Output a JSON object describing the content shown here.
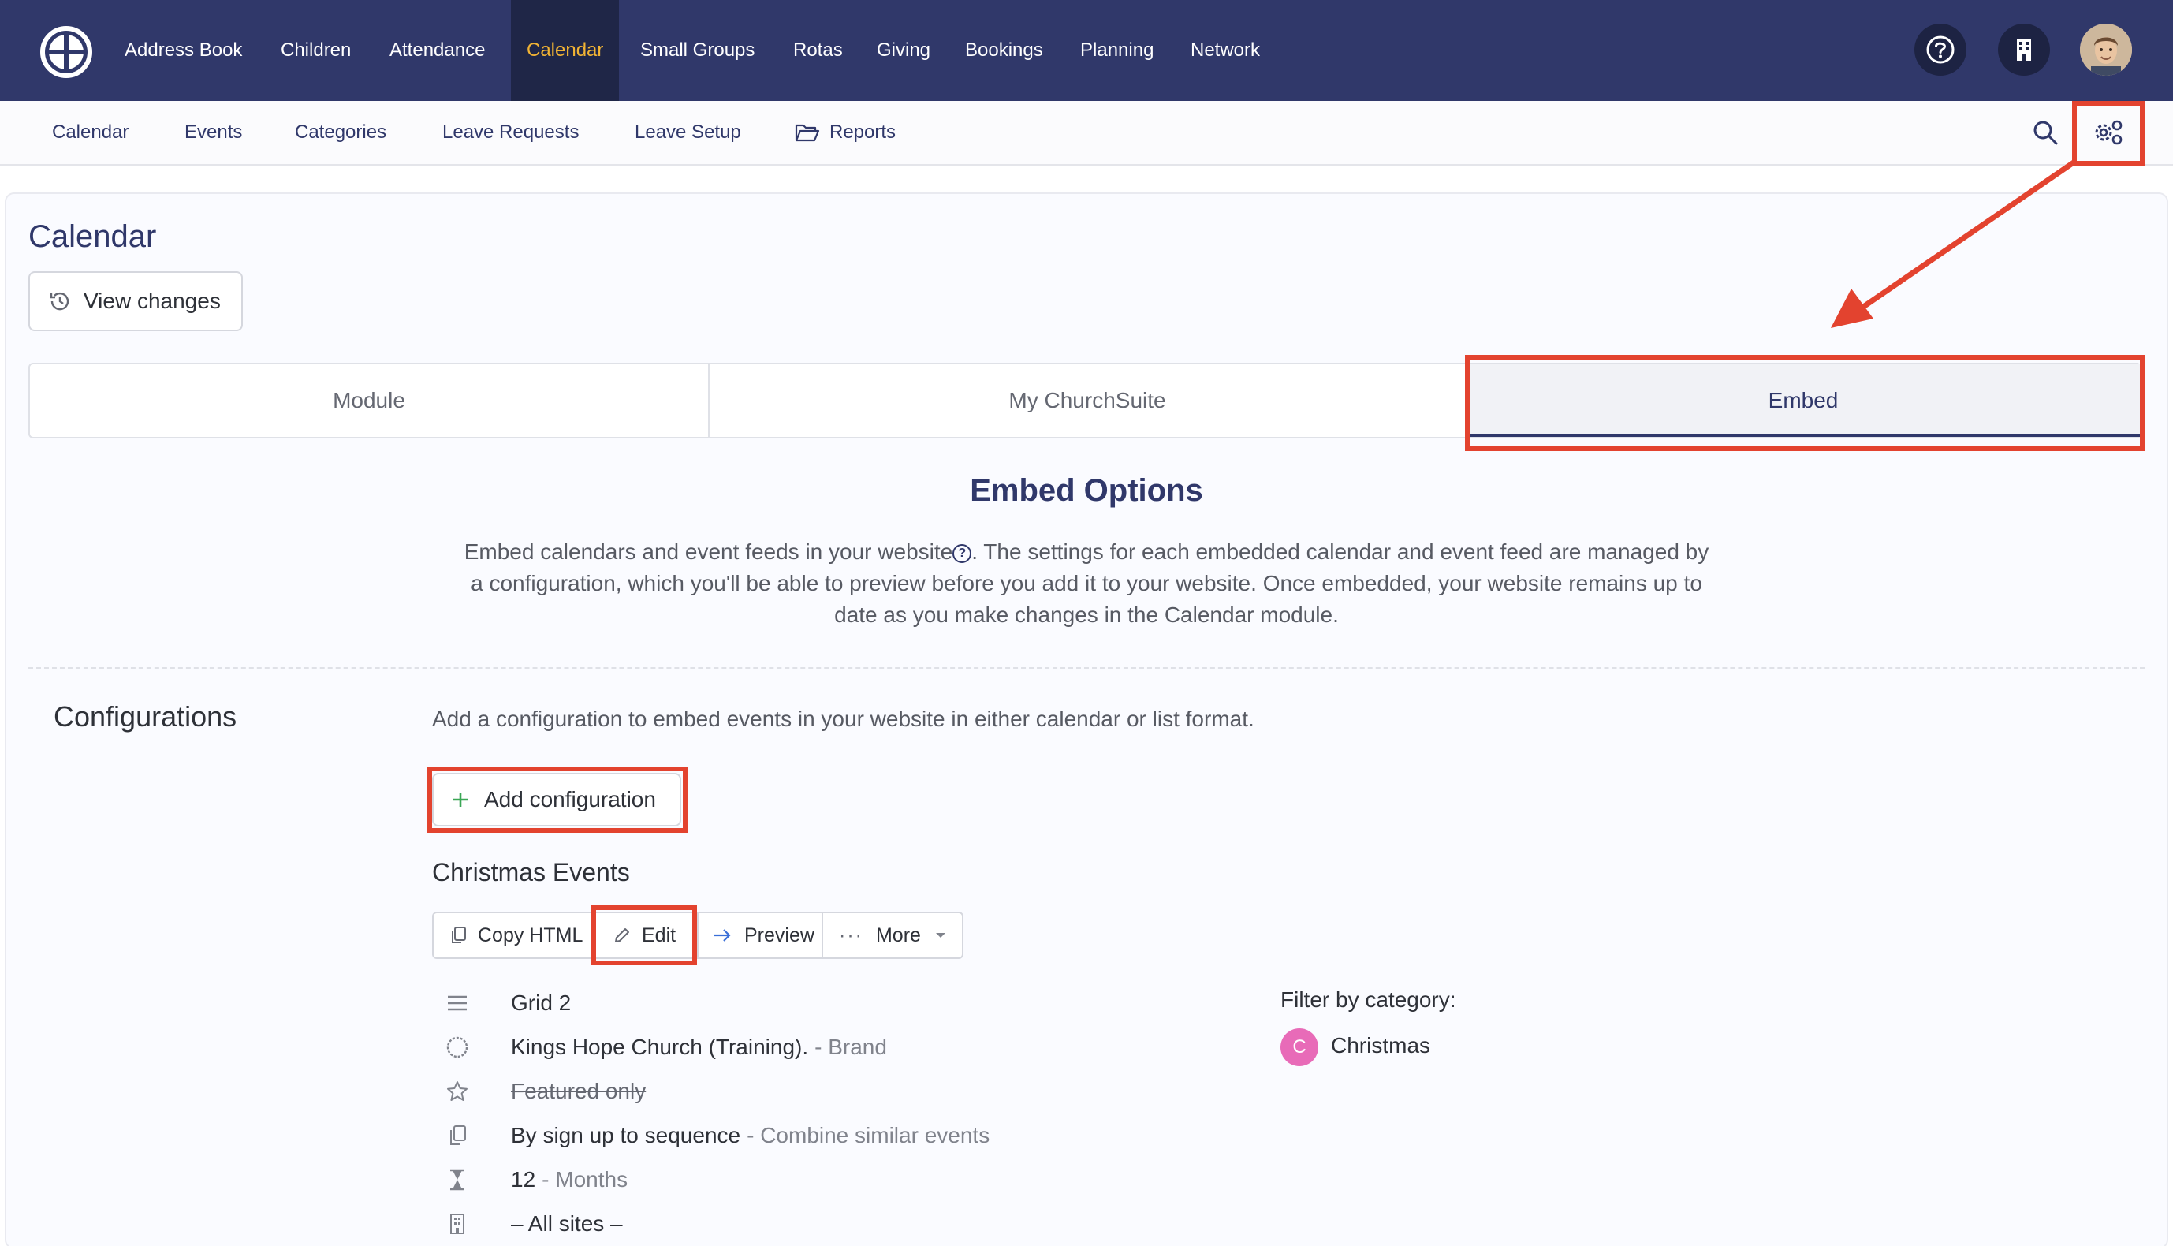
{
  "topnav": {
    "items": [
      {
        "label": "Address Book"
      },
      {
        "label": "Children"
      },
      {
        "label": "Attendance"
      },
      {
        "label": "Calendar"
      },
      {
        "label": "Small Groups"
      },
      {
        "label": "Rotas"
      },
      {
        "label": "Giving"
      },
      {
        "label": "Bookings"
      },
      {
        "label": "Planning"
      },
      {
        "label": "Network"
      }
    ],
    "active_color": "#f2b434",
    "background": "#30386a"
  },
  "subnav": {
    "items": [
      {
        "label": "Calendar"
      },
      {
        "label": "Events"
      },
      {
        "label": "Categories"
      },
      {
        "label": "Leave Requests"
      },
      {
        "label": "Leave Setup"
      },
      {
        "label": "Reports",
        "icon": "folder-open-icon"
      }
    ]
  },
  "page": {
    "title": "Calendar",
    "view_changes": "View changes"
  },
  "tabs": [
    {
      "label": "Module"
    },
    {
      "label": "My ChurchSuite"
    },
    {
      "label": "Embed"
    }
  ],
  "embed": {
    "title": "Embed Options",
    "desc_part1": "Embed calendars and event feeds in your website",
    "desc_part2": ". The settings for each embedded calendar and event feed are managed by a configuration, which you'll be able to preview before you add it to your website. Once embedded, your website remains up to date as you make changes in the Calendar module."
  },
  "configurations": {
    "title": "Configurations",
    "description": "Add a configuration to embed events in your website in either calendar or list format.",
    "add_label": "Add configuration",
    "item": {
      "name": "Christmas Events",
      "buttons": {
        "copy_html": "Copy HTML",
        "edit": "Edit",
        "preview": "Preview",
        "more": "More"
      },
      "settings": [
        {
          "icon": "list-icon",
          "value": "Grid 2",
          "meta": ""
        },
        {
          "icon": "circle-icon",
          "value": "Kings Hope Church (Training).",
          "meta": "- Brand"
        },
        {
          "icon": "star-icon",
          "value": "Featured only",
          "meta": ""
        },
        {
          "icon": "copy-icon",
          "value": "By sign up to sequence",
          "meta": "- Combine similar events"
        },
        {
          "icon": "hourglass-icon",
          "value": "12",
          "meta": "- Months"
        },
        {
          "icon": "building-icon",
          "value": "– All sites –",
          "meta": ""
        }
      ],
      "filter_label": "Filter by category:",
      "category": {
        "initial": "C",
        "label": "Christmas",
        "color": "#e86bb8"
      }
    }
  },
  "annotation_color": "#e3432f"
}
